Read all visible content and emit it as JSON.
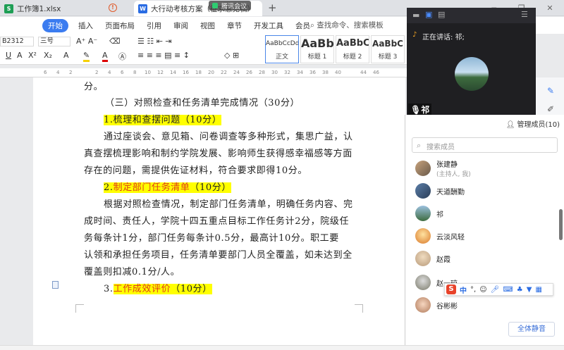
{
  "tabs": [
    {
      "label": "工作簿1.xlsx",
      "icon": "S"
    },
    {
      "label": "大行动考核方案（征求意见稿）",
      "icon": "W"
    }
  ],
  "meeting_pill": "腾讯会议",
  "ribbon": {
    "start": "开始",
    "tabs": [
      "插入",
      "页面布局",
      "引用",
      "审阅",
      "视图",
      "章节",
      "开发工具",
      "会员"
    ],
    "search": "查找命令、搜索模板"
  },
  "toolbar": {
    "style_combo": "B2312",
    "size_combo": "三号",
    "styles": [
      {
        "preview": "AaBbCcDd",
        "name": "正文"
      },
      {
        "preview": "AaBb",
        "name": "标题 1"
      },
      {
        "preview": "AaBbC",
        "name": "标题 2"
      },
      {
        "preview": "AaBbC",
        "name": "标题 3"
      }
    ]
  },
  "doc": {
    "lines": [
      "分。",
      "（三）对照检查和任务清单完成情况（30分）",
      "1.梳理和查摆问题（10分）",
      "通过座谈会、意见箱、问卷调查等多种形式，集思广益，认",
      "真查摆梳理影响和制约学院发展、影响师生获得感幸福感等方面",
      "存在的问题，需提供佐证材料，符合要求即得10分。",
      "2.制定部门任务清单（10分）",
      "根据对照检查情况，制定部门任务清单，明确任务内容、完",
      "成时间、责任人，学院十四五重点目标工作任务计2分，院级任",
      "务每条计1分，部门任务每条计0.5分，最高计10分。职工要",
      "认领和承担任务项目，任务清单要部门人员全覆盖，如未达到全",
      "覆盖则扣减0.1分/人。",
      "3.工作成效评价（10分）"
    ],
    "red_parts": {
      "l7": "制定部门任务清单",
      "l13": "工作成效评价"
    }
  },
  "meeting": {
    "speaking": "正在讲话: 祁;",
    "name_tag": "祁",
    "manage": "管理成员(10)",
    "search_placeholder": "搜索成员",
    "members": [
      {
        "name": "张建静",
        "sub": "(主持人, 我)"
      },
      {
        "name": "天道酬勤"
      },
      {
        "name": "祁"
      },
      {
        "name": "云淡风轻"
      },
      {
        "name": "赵霞"
      },
      {
        "name": "赵一琼"
      },
      {
        "name": "谷彬彬"
      }
    ],
    "mute_all": "全体静音"
  },
  "ime": {
    "logo": "S",
    "mode": "中"
  }
}
